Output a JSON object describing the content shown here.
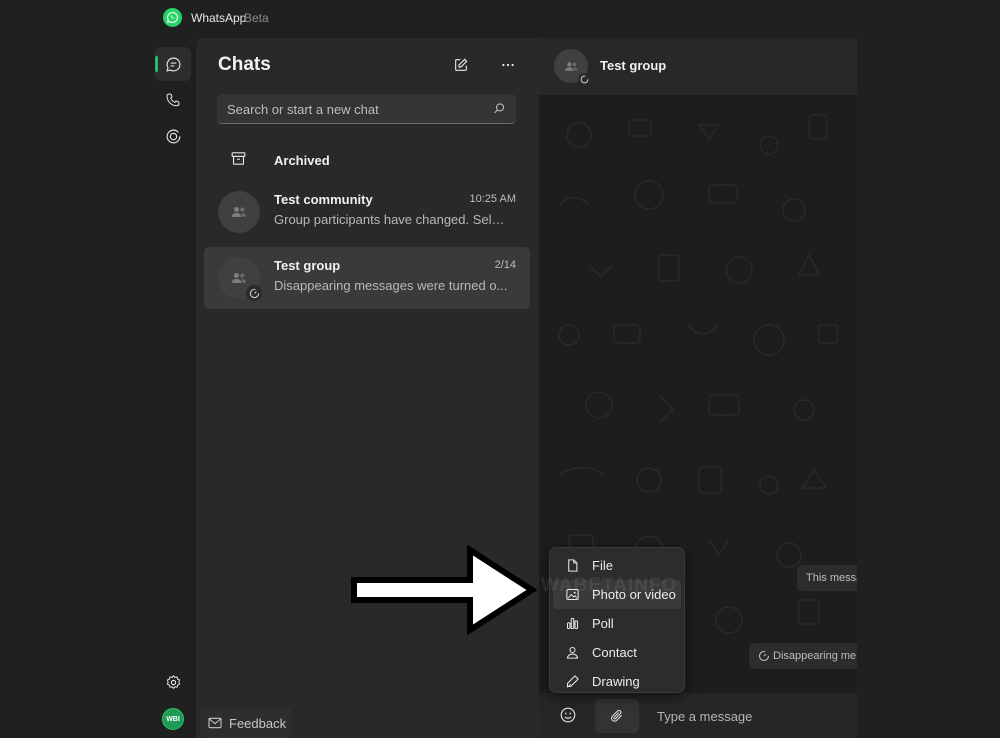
{
  "app": {
    "name": "WhatsApp",
    "badge": "Beta"
  },
  "rail": {
    "items": [
      {
        "name": "chats",
        "icon": "chat-icon",
        "active": true
      },
      {
        "name": "calls",
        "icon": "phone-icon",
        "active": false
      },
      {
        "name": "status",
        "icon": "status-icon",
        "active": false
      }
    ],
    "settings_icon": "gear-icon",
    "profile_initials": "WBI"
  },
  "chatlist": {
    "title": "Chats",
    "search_placeholder": "Search or start a new chat",
    "archived_label": "Archived",
    "chats": [
      {
        "name": "Test community",
        "time": "10:25 AM",
        "preview": "Group participants have changed. Sele...",
        "selected": false
      },
      {
        "name": "Test group",
        "time": "2/14",
        "preview": "Disappearing messages were turned o...",
        "selected": true
      }
    ],
    "feedback_label": "Feedback"
  },
  "conversation": {
    "title": "Test group",
    "bubbles": [
      "This messa",
      "Disappearing me"
    ],
    "composer_placeholder": "Type a message",
    "watermark": "WABETAINFO"
  },
  "attach_menu": {
    "items": [
      {
        "label": "File",
        "icon": "file-icon"
      },
      {
        "label": "Photo or video",
        "icon": "image-icon",
        "highlighted": true
      },
      {
        "label": "Poll",
        "icon": "poll-icon"
      },
      {
        "label": "Contact",
        "icon": "contact-icon"
      },
      {
        "label": "Drawing",
        "icon": "drawing-icon"
      }
    ]
  },
  "colors": {
    "accent": "#21c063",
    "brand": "#25d366",
    "background": "#202020",
    "panel": "#292929"
  }
}
